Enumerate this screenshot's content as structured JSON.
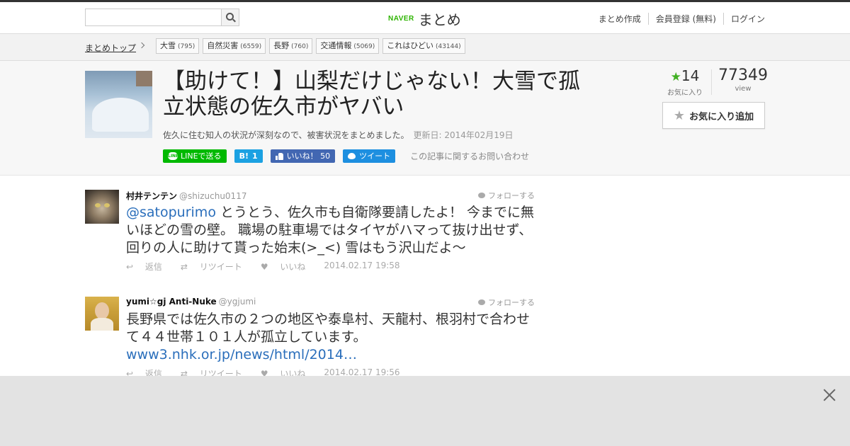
{
  "header": {
    "search_placeholder": "",
    "logo_naver": "NAVER",
    "logo_matome": "まとめ",
    "nav": [
      "まとめ作成",
      "会員登録 (無料)",
      "ログイン"
    ]
  },
  "categories": {
    "top": "まとめトップ",
    "tags": [
      {
        "label": "大雪",
        "count": "(795)"
      },
      {
        "label": "自然災害",
        "count": "(6559)"
      },
      {
        "label": "長野",
        "count": "(760)"
      },
      {
        "label": "交通情報",
        "count": "(5069)"
      },
      {
        "label": "これはひどい",
        "count": "(43144)"
      }
    ]
  },
  "article": {
    "title": "【助けて！】山梨だけじゃない！大雪で孤立状態の佐久市がヤバい",
    "description": "佐久に住む知人の状況が深刻なので、被害状況をまとめました。",
    "updated": "更新日: 2014年02月19日",
    "share": {
      "line": "LINEで送る",
      "hatena_icon": "B!",
      "hatena_count": "1",
      "facebook": "いいね！",
      "facebook_count": "50",
      "twitter": "ツイート"
    },
    "contact": "この記事に関するお問い合わせ",
    "stats": {
      "favorites": "14",
      "favorites_label": "お気に入り",
      "views": "77349",
      "views_label": "view"
    },
    "fav_button": "お気に入り追加"
  },
  "tweets": [
    {
      "name": "村井テンテン",
      "handle": "@shizuchu0117",
      "follow": "フォローする",
      "mention": "@satopurimo",
      "text": " とうとう、佐久市も自衛隊要請したよ！ 今までに無いほどの雪の壁。 職場の駐車場ではタイヤがハマって抜け出せず、回りの人に助けて貰った始末(>_<) 雪はもう沢山だよ～",
      "reply": "返信",
      "retweet": "リツイート",
      "like": "いいね",
      "time": "2014.02.17 19:58"
    },
    {
      "name": "yumi☆gj Anti-Nuke",
      "handle": "@ygjumi",
      "follow": "フォローする",
      "text": "長野県では佐久市の２つの地区や泰阜村、天龍村、根羽村で合わせて４４世帯１０１人が孤立しています。",
      "link": "www3.nhk.or.jp/news/html/2014…",
      "reply": "返信",
      "retweet": "リツイート",
      "like": "いいね",
      "time": "2014.02.17 19:56"
    }
  ],
  "colors": {
    "brand_green": "#2db400",
    "line_green": "#00b900",
    "hatena_blue": "#1ba1e2",
    "facebook_blue": "#4267b2",
    "twitter_blue": "#1d8fe0",
    "link_blue": "#2a6ebb"
  }
}
